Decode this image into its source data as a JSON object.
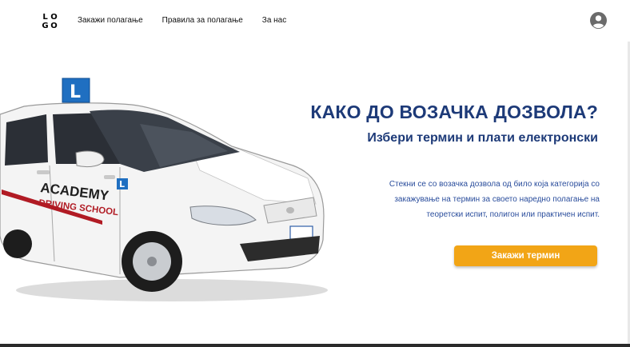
{
  "logo": {
    "letters": [
      "L",
      "O",
      "G",
      "O"
    ]
  },
  "nav": {
    "items": [
      {
        "label": "Закажи полагање"
      },
      {
        "label": "Правила за полагање"
      },
      {
        "label": "За нас"
      }
    ]
  },
  "hero": {
    "title": "КАКО ДО ВОЗАЧКА ДОЗВОЛА?",
    "subtitle": "Избери термин и плати електронски",
    "description": "Стекни се со возачка дозвола од било која категорија со закажување на термин за своето наредно полагање на теоретски испит, полигон или практичен испит.",
    "cta_label": "Закажи термин",
    "image": {
      "roof_sign": "L",
      "door_text_line1": "ACADEMY",
      "door_text_line2": "DRIVING SCHOOL",
      "door_badge": "L"
    }
  },
  "colors": {
    "primary": "#1d3a78",
    "accent": "#f2a516",
    "text_blue": "#2a4d9c"
  },
  "icons": {
    "profile": "user-circle-icon"
  }
}
